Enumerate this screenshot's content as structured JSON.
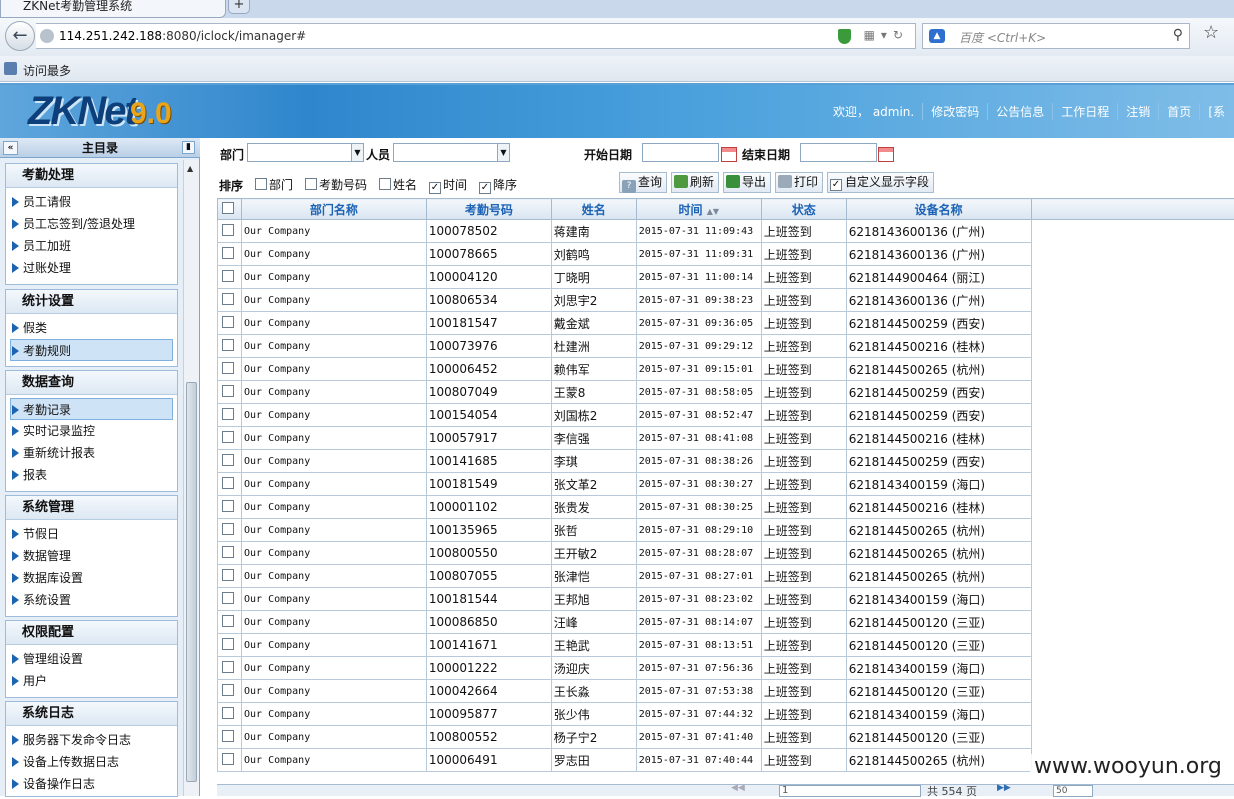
{
  "browser": {
    "tab_title": "ZKNet考勤管理系统",
    "url_host": "114.251.242.188",
    "url_rest": ":8080/iclock/imanager#",
    "search_placeholder": "百度 <Ctrl+K>",
    "bookmark": "访问最多"
  },
  "app": {
    "logo_text": "ZKNet",
    "logo_version": "9.0",
    "top_links": [
      "欢迎， admin.",
      "修改密码",
      "公告信息",
      "工作日程",
      "注销",
      "首页",
      "[系"
    ]
  },
  "sidebar": {
    "title": "主目录",
    "groups": [
      {
        "title": "考勤处理",
        "items": [
          "员工请假",
          "员工忘签到/签退处理",
          "员工加班",
          "过账处理"
        ]
      },
      {
        "title": "统计设置",
        "items": [
          "假类",
          "考勤规则"
        ]
      },
      {
        "title": "数据查询",
        "items": [
          "考勤记录",
          "实时记录监控",
          "重新统计报表",
          "报表"
        ]
      },
      {
        "title": "系统管理",
        "items": [
          "节假日",
          "数据管理",
          "数据库设置",
          "系统设置"
        ]
      },
      {
        "title": "权限配置",
        "items": [
          "管理组设置",
          "用户"
        ]
      },
      {
        "title": "系统日志",
        "items": [
          "服务器下发命令日志",
          "设备上传数据日志",
          "设备操作日志"
        ]
      }
    ],
    "selected": [
      "考勤规则",
      "考勤记录"
    ]
  },
  "filters": {
    "dept_label": "部门",
    "person_label": "人员",
    "start_label": "开始日期",
    "end_label": "结束日期",
    "sort_label": "排序",
    "sort_options": [
      {
        "label": "部门",
        "checked": false
      },
      {
        "label": "考勤号码",
        "checked": false
      },
      {
        "label": "姓名",
        "checked": false
      },
      {
        "label": "时间",
        "checked": true
      },
      {
        "label": "降序",
        "checked": true
      }
    ]
  },
  "toolbar": {
    "query": "查询",
    "refresh": "刷新",
    "export": "导出",
    "print": "打印",
    "custom_fields": "自定义显示字段"
  },
  "table": {
    "columns": [
      "部门名称",
      "考勤号码",
      "姓名",
      "时间",
      "状态",
      "设备名称"
    ],
    "rows": [
      [
        "Our Company",
        "100078502",
        "蒋建南",
        "2015-07-31 11:09:43",
        "上班签到",
        "6218143600136 (广州)"
      ],
      [
        "Our Company",
        "100078665",
        "刘鹤鸣",
        "2015-07-31 11:09:31",
        "上班签到",
        "6218143600136 (广州)"
      ],
      [
        "Our Company",
        "100004120",
        "丁晓明",
        "2015-07-31 11:00:14",
        "上班签到",
        "6218144900464 (丽江)"
      ],
      [
        "Our Company",
        "100806534",
        "刘思宇2",
        "2015-07-31 09:38:23",
        "上班签到",
        "6218143600136 (广州)"
      ],
      [
        "Our Company",
        "100181547",
        "戴金斌",
        "2015-07-31 09:36:05",
        "上班签到",
        "6218144500259 (西安)"
      ],
      [
        "Our Company",
        "100073976",
        "杜建洲",
        "2015-07-31 09:29:12",
        "上班签到",
        "6218144500216 (桂林)"
      ],
      [
        "Our Company",
        "100006452",
        "赖伟军",
        "2015-07-31 09:15:01",
        "上班签到",
        "6218144500265 (杭州)"
      ],
      [
        "Our Company",
        "100807049",
        "王蒙8",
        "2015-07-31 08:58:05",
        "上班签到",
        "6218144500259 (西安)"
      ],
      [
        "Our Company",
        "100154054",
        "刘国栋2",
        "2015-07-31 08:52:47",
        "上班签到",
        "6218144500259 (西安)"
      ],
      [
        "Our Company",
        "100057917",
        "李信强",
        "2015-07-31 08:41:08",
        "上班签到",
        "6218144500216 (桂林)"
      ],
      [
        "Our Company",
        "100141685",
        "李琪",
        "2015-07-31 08:38:26",
        "上班签到",
        "6218144500259 (西安)"
      ],
      [
        "Our Company",
        "100181549",
        "张文革2",
        "2015-07-31 08:30:27",
        "上班签到",
        "6218143400159 (海口)"
      ],
      [
        "Our Company",
        "100001102",
        "张贵发",
        "2015-07-31 08:30:25",
        "上班签到",
        "6218144500216 (桂林)"
      ],
      [
        "Our Company",
        "100135965",
        "张哲",
        "2015-07-31 08:29:10",
        "上班签到",
        "6218144500265 (杭州)"
      ],
      [
        "Our Company",
        "100800550",
        "王开敏2",
        "2015-07-31 08:28:07",
        "上班签到",
        "6218144500265 (杭州)"
      ],
      [
        "Our Company",
        "100807055",
        "张津恺",
        "2015-07-31 08:27:01",
        "上班签到",
        "6218144500265 (杭州)"
      ],
      [
        "Our Company",
        "100181544",
        "王邦旭",
        "2015-07-31 08:23:02",
        "上班签到",
        "6218143400159 (海口)"
      ],
      [
        "Our Company",
        "100086850",
        "汪峰",
        "2015-07-31 08:14:07",
        "上班签到",
        "6218144500120 (三亚)"
      ],
      [
        "Our Company",
        "100141671",
        "王艳武",
        "2015-07-31 08:13:51",
        "上班签到",
        "6218144500120 (三亚)"
      ],
      [
        "Our Company",
        "100001222",
        "汤迎庆",
        "2015-07-31 07:56:36",
        "上班签到",
        "6218143400159 (海口)"
      ],
      [
        "Our Company",
        "100042664",
        "王长淼",
        "2015-07-31 07:53:38",
        "上班签到",
        "6218144500120 (三亚)"
      ],
      [
        "Our Company",
        "100095877",
        "张少伟",
        "2015-07-31 07:44:32",
        "上班签到",
        "6218143400159 (海口)"
      ],
      [
        "Our Company",
        "100800552",
        "杨子宁2",
        "2015-07-31 07:41:40",
        "上班签到",
        "6218144500120 (三亚)"
      ],
      [
        "Our Company",
        "100006491",
        "罗志田",
        "2015-07-31 07:40:44",
        "上班签到",
        "6218144500265 (杭州)"
      ]
    ]
  },
  "pager": {
    "page_input": "1",
    "total_text": "共 554 页",
    "page_size": "50"
  },
  "watermark": "www.wooyun.org",
  "colors": {
    "header_blue": "#2f86cc",
    "column_header_text": "#1c63b5",
    "logo_version": "#e8a41a"
  }
}
